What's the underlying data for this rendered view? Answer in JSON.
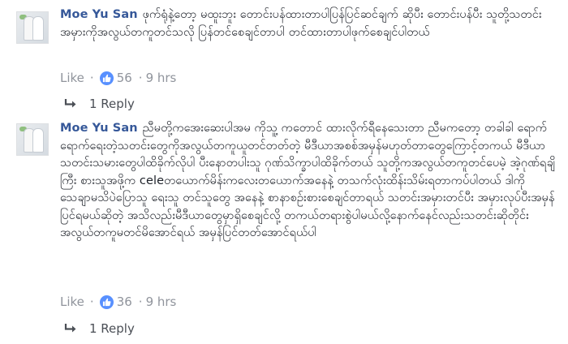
{
  "comments": [
    {
      "author": "Moe Yu San",
      "text": "ဖုက်ရုံနဲ့တော့ မထူးဘူး တောင်းပန်ထားတာပါပြန်ပြင်ဆင်ချက် ဆိုပီး တောင်းပန်ပီး သူတို့သတင်းအမှားကိုအလွယ်တကူတင်သလို ပြန်တင်စေချင်တာပါ တင်ထားတာပါဖုက်စေချင်ပါတယ်",
      "like_label": "Like",
      "like_count": "56",
      "time": "9 hrs",
      "reply_label": "1 Reply"
    },
    {
      "author": "Moe Yu San",
      "text": "ညီမတို့ကအေးဆေးပါအမ ကိုသူ့ ကတောင် ထားလိုက်ရီနေသေးတာ ညီမကတော့ တခါခါ ရောက်ရောက်ရေးတဲ့သတင်းတွေကိုအလွယ်တကူယူတင်တတ်တဲ့ မီဒီယာအစစ်အမှန်မဟုတ်တာတွေကြောင့်တကယ် မီဒီယာသတင်းသမားတွေပါထိခိုက်လိုပါ ပီးနောတပါးသူ ဂုဏ်သိက္ခာပါထိခိုက်တယ် သူတို့ကအလွယ်တကူတင်ပေမဲ့ အဲ့ဂုဏ်ရချိကြီး စားသူအဖို့က celeတယောက်မိန်းကလေးတယောက်အနေနဲ့ တသက်လုံးထိန်းသိမ်းရတာကပ်ပါတယ် ဒါကိုသေချာမသိပဲပြောသူ ရေးသူ တင်သူတွေ အနေနဲ့ စာနာစဉ်းစားစေချင်တာရယ် သတင်းအမှားတင်ပီး အမှားလုပ်ပီးအမှန်ပြင်ရမယ်ဆိုတဲ့ အသိလည်းမီဒီယာတွေမှာရှိစေချင်လို့ တကယ်တရားစွဲပါမယ်လို့နောက်နေင်လည်းသတင်းဆိုတိုင်းအလွယ်တကူမတင်မိအောင်ရယ် အမှန်ပြင်တတ်အောင်ရယ်ပါ",
      "like_label": "Like",
      "like_count": "36",
      "time": "9 hrs",
      "reply_label": "1 Reply"
    }
  ],
  "icons": {
    "avatar": "profile-photo",
    "like": "thumbs-up-icon",
    "reply": "reply-arrow-icon"
  },
  "colors": {
    "author": "#365899",
    "meta": "#90949c",
    "like_badge": "#5890ff"
  }
}
